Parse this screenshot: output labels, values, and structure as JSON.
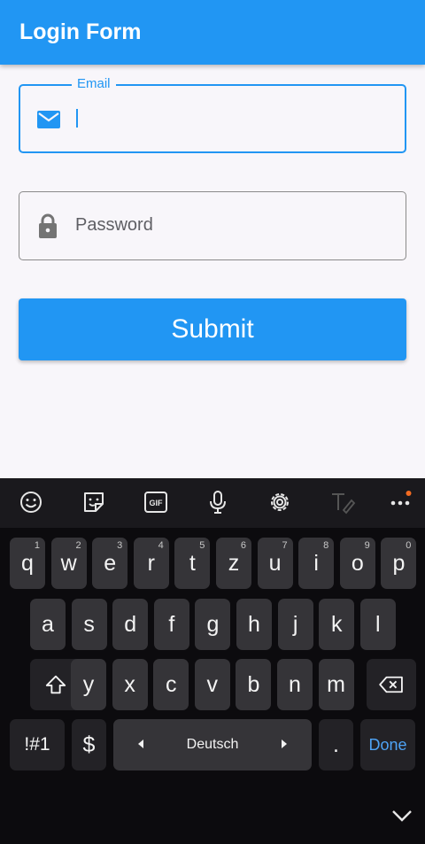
{
  "app_bar": {
    "title": "Login Form"
  },
  "form": {
    "email": {
      "label": "Email",
      "value": ""
    },
    "password": {
      "placeholder": "Password"
    },
    "submit_label": "Submit"
  },
  "keyboard": {
    "toolbar_icons": [
      "emoji-icon",
      "sticker-icon",
      "gif-icon",
      "mic-icon",
      "settings-icon",
      "handwriting-icon",
      "more-icon"
    ],
    "gif_label": "GIF",
    "row1": [
      {
        "k": "q",
        "n": "1"
      },
      {
        "k": "w",
        "n": "2"
      },
      {
        "k": "e",
        "n": "3"
      },
      {
        "k": "r",
        "n": "4"
      },
      {
        "k": "t",
        "n": "5"
      },
      {
        "k": "z",
        "n": "6"
      },
      {
        "k": "u",
        "n": "7"
      },
      {
        "k": "i",
        "n": "8"
      },
      {
        "k": "o",
        "n": "9"
      },
      {
        "k": "p",
        "n": "0"
      }
    ],
    "row2": [
      "a",
      "s",
      "d",
      "f",
      "g",
      "h",
      "j",
      "k",
      "l"
    ],
    "row3": [
      "y",
      "x",
      "c",
      "v",
      "b",
      "n",
      "m"
    ],
    "symbols_label": "!#1",
    "currency_label": "$",
    "space_label": "Deutsch",
    "period_label": ".",
    "done_label": "Done",
    "accent_color": "#2196f3"
  }
}
